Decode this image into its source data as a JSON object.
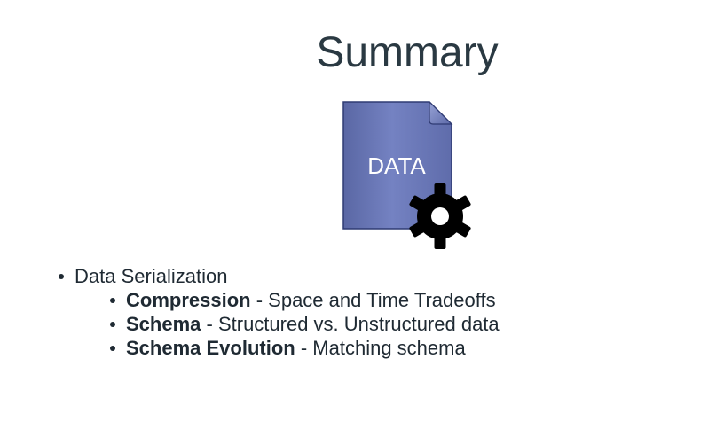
{
  "slide": {
    "title": "Summary",
    "graphic": {
      "label": "DATA",
      "icon": "data-document-gear-icon",
      "doc_color": "#6a78b5",
      "gear_color": "#000000"
    },
    "bullets": [
      {
        "text": "Data Serialization",
        "children": [
          {
            "term": "Compression",
            "separator": " - ",
            "desc": "Space and Time Tradeoffs"
          },
          {
            "term": "Schema",
            "separator": " - ",
            "desc": "Structured vs. Unstructured data"
          },
          {
            "term": "Schema Evolution",
            "separator": " - ",
            "desc": "Matching schema"
          }
        ]
      }
    ]
  }
}
